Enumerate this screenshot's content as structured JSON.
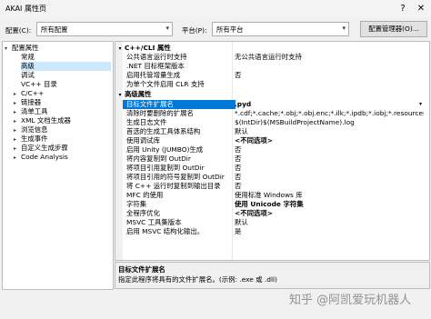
{
  "window": {
    "title": "AKAI 属性页",
    "help": "?",
    "close": "✕"
  },
  "toolbar": {
    "config_label": "配置(C):",
    "config_value": "所有配置",
    "platform_label": "平台(P):",
    "platform_value": "所有平台",
    "manager_button": "配置管理器(O)..."
  },
  "tree": {
    "items": [
      {
        "label": "配置属性",
        "arrow": "▾"
      },
      {
        "label": "常规",
        "arrow": ""
      },
      {
        "label": "高级",
        "arrow": ""
      },
      {
        "label": "调试",
        "arrow": ""
      },
      {
        "label": "VC++ 目录",
        "arrow": ""
      },
      {
        "label": "C/C++",
        "arrow": "▸"
      },
      {
        "label": "链接器",
        "arrow": "▸"
      },
      {
        "label": "清单工具",
        "arrow": "▸"
      },
      {
        "label": "XML 文档生成器",
        "arrow": "▸"
      },
      {
        "label": "浏览信息",
        "arrow": "▸"
      },
      {
        "label": "生成事件",
        "arrow": "▸"
      },
      {
        "label": "自定义生成步骤",
        "arrow": "▸"
      },
      {
        "label": "Code Analysis",
        "arrow": "▸"
      }
    ]
  },
  "grid": {
    "cat1": "C++/CLI 属性",
    "cat1_rows": [
      {
        "name": "公共语言运行时支持",
        "value": "无公共语言运行时支持"
      },
      {
        "name": ".NET 目标框架版本",
        "value": ""
      },
      {
        "name": "启用托管增量生成",
        "value": "否"
      },
      {
        "name": "为单个文件启用 CLR 支持",
        "value": ""
      }
    ],
    "cat2": "高级属性",
    "cat2_rows": [
      {
        "name": "目标文件扩展名",
        "value": ".pyd"
      },
      {
        "name": "清除时要删除的扩展名",
        "value": "*.cdf;*.cache;*.obj;*.obj.enc;*.ilk;*.ipdb;*.iobj;*.resources;*.tlb;*.tli;*.t"
      },
      {
        "name": "生成日志文件",
        "value": "$(IntDir)$(MSBuildProjectName).log"
      },
      {
        "name": "首选的生成工具体系结构",
        "value": "默认"
      },
      {
        "name": "使用调试库",
        "value": "<不同选项>"
      },
      {
        "name": "启用 Unity (JUMBO)生成",
        "value": "否"
      },
      {
        "name": "将内容复制到 OutDir",
        "value": "否"
      },
      {
        "name": "将项目引用复制到 OutDir",
        "value": "否"
      },
      {
        "name": "将项目引用的符号复制到 OutDir",
        "value": "否"
      },
      {
        "name": "将 C++ 运行时复制到输出目录",
        "value": "否"
      },
      {
        "name": "MFC 的使用",
        "value": "使用标准 Windows 库"
      },
      {
        "name": "字符集",
        "value": "使用 Unicode 字符集"
      },
      {
        "name": "全程序优化",
        "value": "<不同选项>"
      },
      {
        "name": "MSVC 工具集版本",
        "value": "默认"
      },
      {
        "name": "启用 MSVC 结构化输出。",
        "value": "是"
      }
    ]
  },
  "description": {
    "title": "目标文件扩展名",
    "text": "指定此程序将具有的文件扩展名。(示例: .exe 或 .dll)"
  },
  "watermark": "知乎 @阿凯爱玩机器人"
}
